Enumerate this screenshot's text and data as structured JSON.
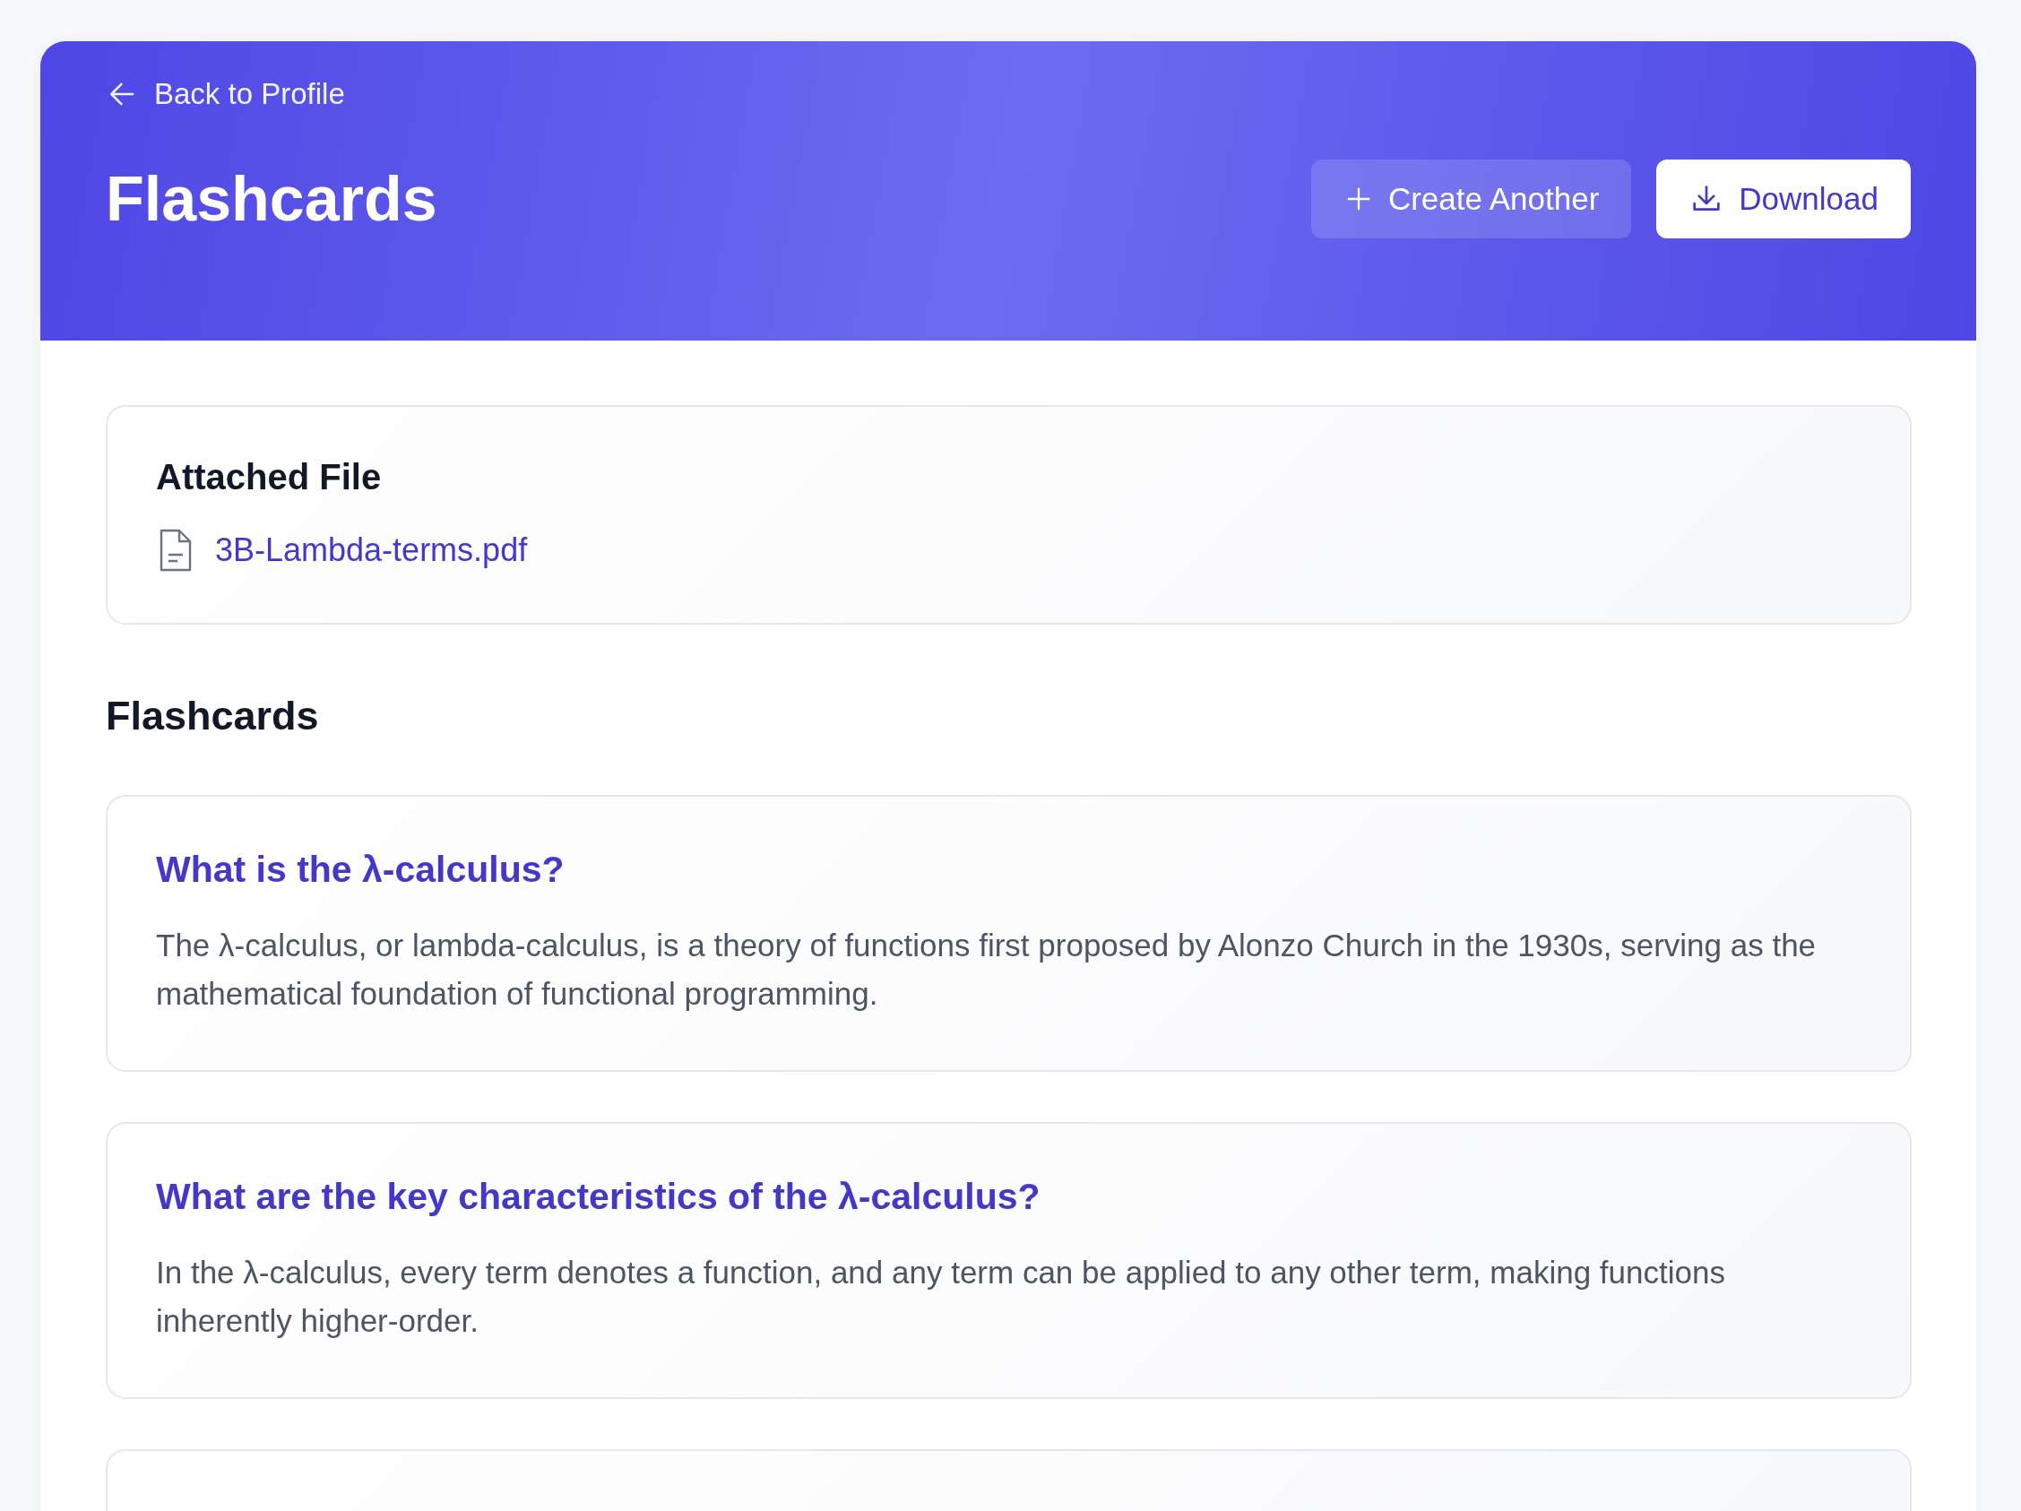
{
  "header": {
    "back_link": "Back to Profile",
    "title": "Flashcards",
    "buttons": [
      {
        "kind": "create",
        "label": "Create Another"
      },
      {
        "kind": "download",
        "label": "Download"
      }
    ]
  },
  "attached_file": {
    "heading": "Attached File",
    "file_name": "3B-Lambda-terms.pdf"
  },
  "flashcards_heading": "Flashcards",
  "flashcards": [
    {
      "question": "What is the λ-calculus?",
      "answer": "The λ-calculus, or lambda-calculus, is a theory of functions first proposed by Alonzo Church in the 1930s, serving as the mathematical foundation of functional programming."
    },
    {
      "question": "What are the key characteristics of the λ-calculus?",
      "answer": "In the λ-calculus, every term denotes a function, and any term can be applied to any other term, making functions inherently higher-order."
    }
  ]
}
